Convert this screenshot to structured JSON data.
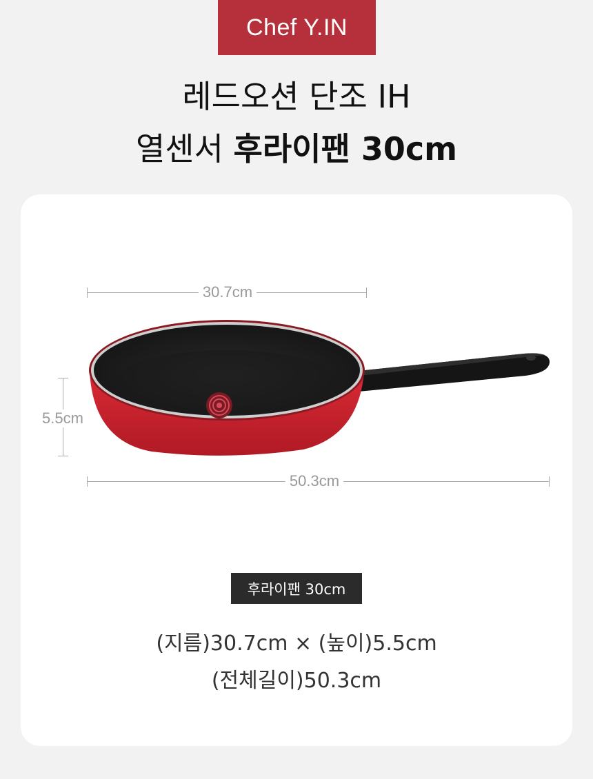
{
  "brand": "Chef Y.IN",
  "title": {
    "line1": "레드오션 단조 IH",
    "line2_regular": "열센서 ",
    "line2_bold": "후라이팬 30cm"
  },
  "dimensions": {
    "diameter": "30.7cm",
    "height": "5.5cm",
    "total_length": "50.3cm"
  },
  "product_tag": "후라이팬 30cm",
  "specs": {
    "line1": "(지름)30.7cm × (높이)5.5cm",
    "line2": "(전체길이)50.3cm"
  },
  "colors": {
    "brand_bg": "#b5303b",
    "pan_red": "#c8202c",
    "pan_inner": "#1e1e1e",
    "tag_bg": "#2b2b2b"
  }
}
